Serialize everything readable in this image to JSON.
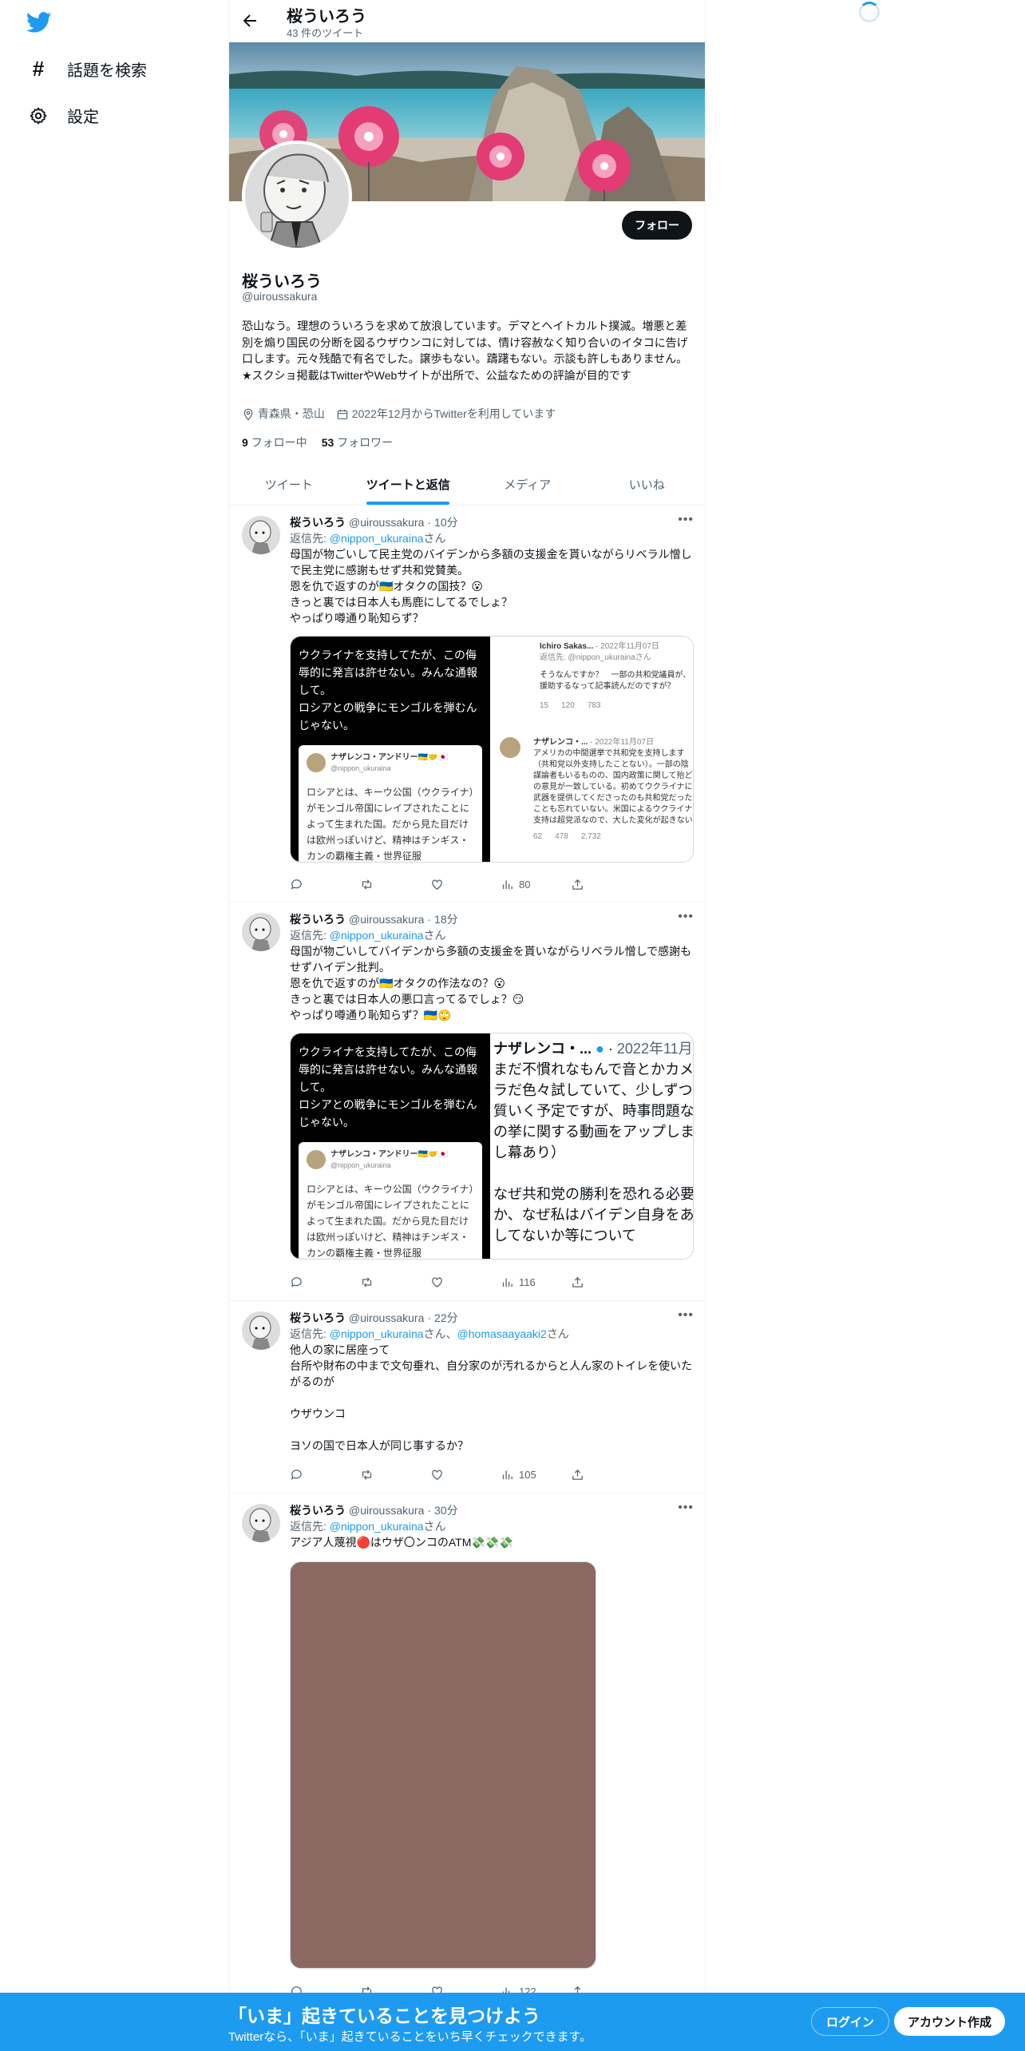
{
  "colors": {
    "accent": "#1d9bf0",
    "text": "#0f1419",
    "muted": "#536471",
    "media_placeholder": "#8b6862"
  },
  "nav": {
    "logo_icon": "twitter-bird-icon",
    "explore_label": "話題を検索",
    "settings_label": "設定"
  },
  "header": {
    "title": "桜ういろう",
    "tweet_count": "43 件のツイート"
  },
  "profile": {
    "name": "桜ういろう",
    "handle": "@uiroussakura",
    "follow_button": "フォロー",
    "bio": "恐山なう。理想のういろうを求めて放浪しています。デマとヘイトカルト撲滅。増悪と差別を煽り国民の分断を図るウザウンコに対しては、情け容赦なく知り合いのイタコに告げ口します。元々残酷で有名でした。譲歩もない。躊躇もない。示談も許しもありません。★スクショ掲載はTwitterやWebサイトが出所で、公益なための評論が目的です",
    "location": "青森県・恐山",
    "joined": "2022年12月からTwitterを利用しています",
    "following_count": "9",
    "following_label": "フォロー中",
    "followers_count": "53",
    "followers_label": "フォロワー"
  },
  "tabs": [
    "ツイート",
    "ツイートと返信",
    "メディア",
    "いいね"
  ],
  "tweets": [
    {
      "name": "桜ういろう",
      "handle": "@uiroussakura",
      "time": "10分",
      "reply_prefix": "返信先: ",
      "reply_to": "@nippon_ukuraina",
      "reply_suffix": "さん",
      "text": "母国が物ごいして民主党のバイデンから多額の支援金を貰いながらリベラル憎しで民主党に感謝もせず共和党賛美。\n恩を仇で返すのが🇺🇦オタクの国技？😮\nきっと裏では日本人も馬鹿にしてるでしょ？\nやっぱり噂通り恥知らず？",
      "media_left_text": "ウクライナを支持してたが、この侮辱的に発言は許せない。みんな通報して。\nロシアとの戦争にモンゴルを弾むんじゃない。",
      "media_left_card_name": "ナザレンコ・アンドリー🇺🇦🤝🇯🇵",
      "media_left_card_handle": "@nippon_ukuraina",
      "media_left_card_text": "ロシアとは、キーウ公国（ウクライナ）がモンゴル帝国にレイプされたことによって生まれた国。だから見た目だけは欧州っぽいけど、精神はチンギス・カンの覇権主義・世界征服",
      "media_right_top_name": "Ichiro Sakas...",
      "media_right_top_date": "2022年11月07日",
      "media_right_top_reply": "返信先: @nippon_ukurainaさん",
      "media_right_top_text": "そうなんですか？　一部の共和党議員が、援助するなって記事読んだのですが？",
      "media_right_top_stats": [
        "15",
        "120",
        "783"
      ],
      "media_right_bottom_name": "ナザレンコ・...",
      "media_right_bottom_date": "2022年11月07日",
      "media_right_bottom_text": "アメリカの中間選挙で共和党を支持します（共和党以外支持したことない）。一部の陰謀論者もいるものの、国内政策に関して殆どの意見が一致している。初めてウクライナに武器を提供してくださったのも共和党だったことも忘れていない。米国によるウクライナ支持は超党派なので、大した変化が起きない",
      "media_right_bottom_stats": [
        "62",
        "478",
        "2,732"
      ],
      "views": "80"
    },
    {
      "name": "桜ういろう",
      "handle": "@uiroussakura",
      "time": "18分",
      "reply_prefix": "返信先: ",
      "reply_to": "@nippon_ukuraina",
      "reply_suffix": "さん",
      "text": "母国が物ごいしてバイデンから多額の支援金を貰いながらリベラル憎しで感謝もせずハイデン批判。\n恩を仇で返すのが🇺🇦オタクの作法なの？😮\nきっと裏では日本人の悪口言ってるでしょ？😏\nやっぱり噂通り恥知らず？🇺🇦🙄",
      "media_left_text": "ウクライナを支持してたが、この侮辱的に発言は許せない。みんな通報して。\nロシアとの戦争にモンゴルを弾むんじゃない。",
      "media_left_card_name": "ナザレンコ・アンドリー🇺🇦🤝🇯🇵",
      "media_left_card_handle": "@nippon_ukuraina",
      "media_left_card_text": "ロシアとは、キーウ公国（ウクライナ）がモンゴル帝国にレイプされたことによって生まれた国。だから見た目だけは欧州っぽいけど、精神はチンギス・カンの覇権主義・世界征服",
      "media_right_zoom_name": "ナザレンコ・...",
      "media_right_zoom_date": "2022年11月",
      "media_right_zoom_text1": "まだ不慣れなもんで音とかカメラだ色々試していて、少しずつ質いく予定ですが、時事問題なの挙に関する動画をアップしまし幕あり）",
      "media_right_zoom_text2": "なぜ共和党の勝利を恐れる必要か、なぜ私はバイデン自身をあしてないか等について",
      "views": "116"
    },
    {
      "name": "桜ういろう",
      "handle": "@uiroussakura",
      "time": "22分",
      "reply_prefix": "返信先: ",
      "reply_to": "@nippon_ukuraina",
      "reply_mid": "さん、",
      "reply_to2": "@homasaayaaki2",
      "reply_suffix": "さん",
      "text": "他人の家に居座って\n台所や財布の中まで文句垂れ、自分家のが汚れるからと人ん家のトイレを使いたがるのが\n\nウザウンコ\n\nヨソの国で日本人が同じ事するか？",
      "views": "105"
    },
    {
      "name": "桜ういろう",
      "handle": "@uiroussakura",
      "time": "30分",
      "reply_prefix": "返信先: ",
      "reply_to": "@nippon_ukuraina",
      "reply_suffix": "さん",
      "text": "アジア人蔑視🔴はウザ〇ンコのATM💸💸💸",
      "views": "122"
    }
  ],
  "bottom": {
    "title": "「いま」起きていることを見つけよう",
    "subtitle": "Twitterなら、「いま」起きていることをいち早くチェックできます。",
    "login": "ログイン",
    "signup": "アカウント作成"
  }
}
